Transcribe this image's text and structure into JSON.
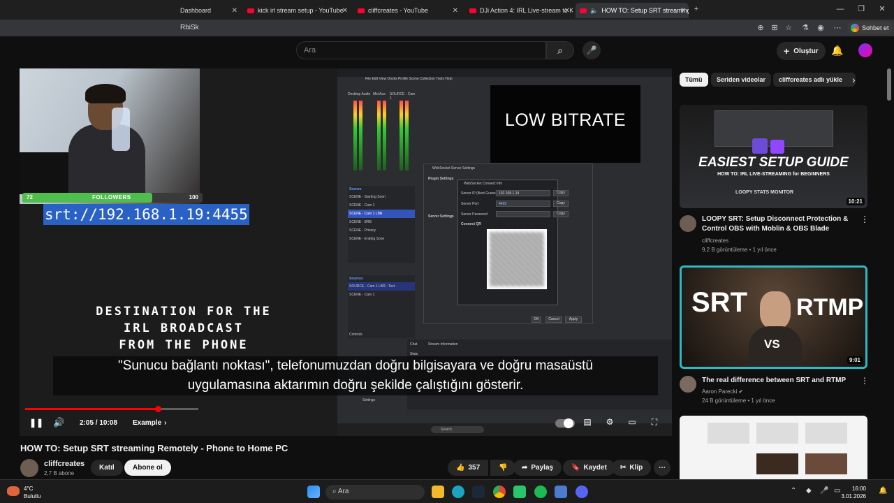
{
  "browser": {
    "tabs": [
      {
        "label": "Dashboard"
      },
      {
        "label": "kick irl stream setup - YouTube"
      },
      {
        "label": "cliffcreates - YouTube"
      },
      {
        "label": "DJi Action 4: IRL Live-stream to Ki"
      },
      {
        "label": "HOW TO: Setup SRT streaming"
      }
    ],
    "address_text": "RbiSk",
    "chat_button": "Sohbet et"
  },
  "youtube_header": {
    "search_placeholder": "Ara",
    "create_label": "Oluştur"
  },
  "video": {
    "obs": {
      "menu": "File  Edit  View  Docks  Profile  Scene Collection  Tools  Help",
      "mixer": [
        "Desktop Audio",
        "Mic/Aux",
        "SOURCE - Cam 1"
      ],
      "preview_text": "LOW BITRATE",
      "scenes_header": "Scenes",
      "scenes": [
        "SCENE - Starting Soon",
        "SCENE - Cam 1",
        "SCENE - Cam 1 LBR",
        "SCENE - BRB",
        "SCENE - Privacy",
        "SCENE - Ending Soon"
      ],
      "sources_header": "Sources",
      "sources": [
        "SOURCE - Cam 1 LBR - Text",
        "SCENE - Cam 1"
      ],
      "dialog": {
        "title": "WebSocket Server Settings",
        "plugin_settings": "Plugin Settings",
        "server_settings": "Server Settings",
        "connect_info": "WebSocket Connect Info",
        "server_ip_label": "Server IP (Best Guess)",
        "server_ip": "192.168.1.19",
        "server_port_label": "Server Port",
        "server_port": "4455",
        "server_password_label": "Server Password",
        "copy": "Copy",
        "connect_qr": "Connect QR",
        "ok": "OK",
        "cancel": "Cancel",
        "apply": "Apply"
      },
      "bottom_tabs": [
        "Chat",
        "Stream Information"
      ],
      "stats_label": "Stats",
      "settings_label": "Settings",
      "controls_label": "Controls",
      "mini_search": "Search"
    },
    "webcam": {
      "followers_current": "72",
      "followers_label": "FOLLOWERS",
      "followers_goal": "100",
      "followers_progress": 0.72
    },
    "srt_url": "srt://192.168.1.19:4455",
    "overlay_caption": [
      "DESTINATION FOR THE",
      "IRL BROADCAST",
      "FROM THE PHONE"
    ],
    "subtitle_lines": [
      "\"Sunucu bağlantı noktası\", telefonumuzdan doğru bilgisayara ve doğru masaüstü",
      "uygulamasına aktarımın doğru şekilde çalıştığını gösterir."
    ],
    "time": "2:05 / 10:08",
    "chapter": "Example",
    "progress": 0.21
  },
  "meta": {
    "title": "HOW TO: Setup SRT streaming Remotely - Phone to Home PC",
    "channel": "cliffcreates",
    "subscribers": "2,7 B abone",
    "join": "Katıl",
    "subscribe": "Abone ol",
    "likes": "357",
    "share": "Paylaş",
    "save": "Kaydet",
    "clip": "Klip"
  },
  "sidebar": {
    "chips": [
      "Tümü",
      "Seriden videolar",
      "cliffcreates adlı yükle"
    ],
    "recs": [
      {
        "thumb_title": "EASIEST SETUP GUIDE",
        "thumb_subtitle": "HOW TO: IRL LIVE-STREAMING for BEGINNERS",
        "thumb_badge": "LOOPY STATS MONITOR",
        "duration": "10:21",
        "title": "LOOPY SRT: Setup Disconnect Protection & Control OBS with Moblin & OBS Blade",
        "channel": "cliffcreates",
        "stats": "9,2 B görüntüleme • 1 yıl önce"
      },
      {
        "thumb_left": "SRT",
        "thumb_right": "RTMP",
        "thumb_mid": "VS",
        "duration": "9:01",
        "title": "The real difference between SRT and RTMP",
        "channel": "Aaron Parecki",
        "stats": "24 B görüntüleme • 1 yıl önce"
      }
    ]
  },
  "taskbar": {
    "temp": "4°C",
    "weather": "Bulutlu",
    "search": "Ara",
    "time": "16:00",
    "date": "3.01.2026"
  },
  "colors": {
    "youtube_red": "#ff0000",
    "accent_blue": "#2a61c4",
    "followers_green": "#4fbe4f"
  }
}
